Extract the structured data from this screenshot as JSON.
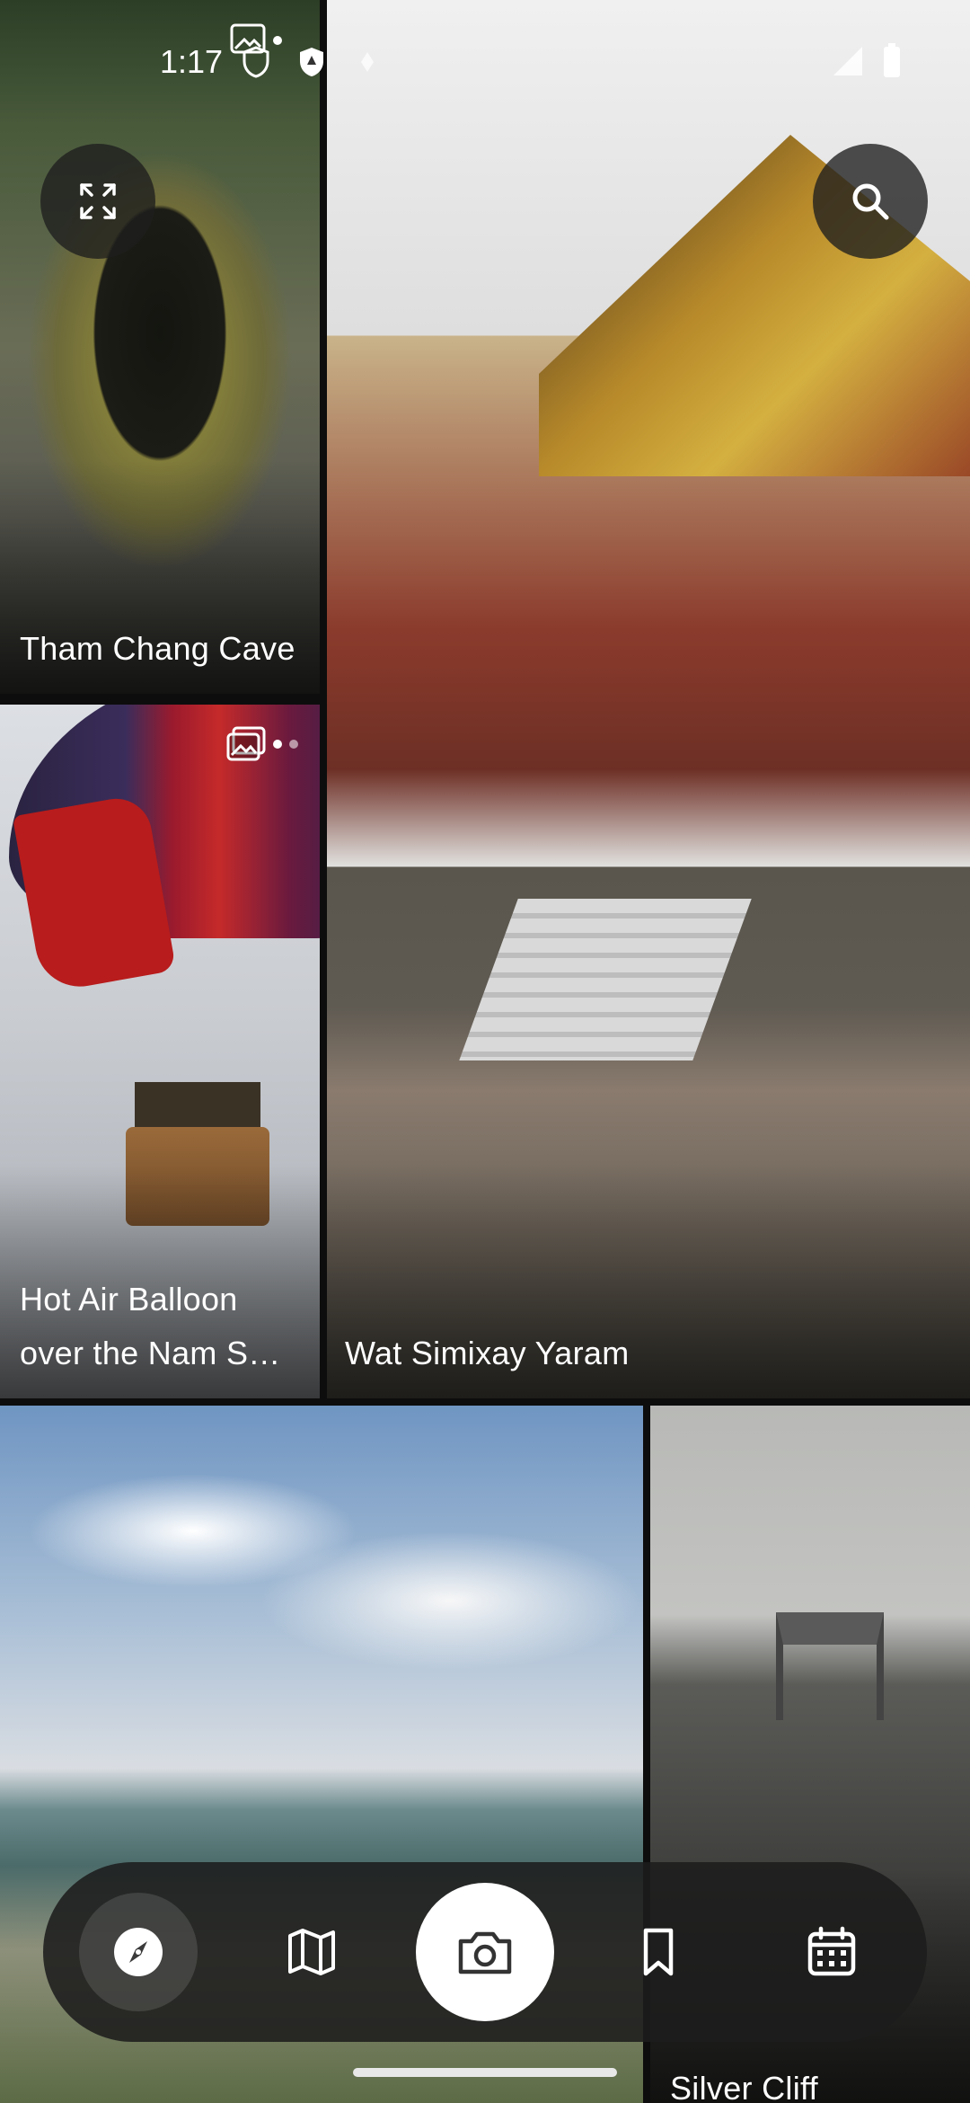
{
  "status_bar": {
    "time": "1:17"
  },
  "tiles": [
    {
      "caption": "Tham Chang Cave"
    },
    {
      "caption": "Hot Air Balloon over the Nam S…"
    },
    {
      "caption": "Wat Simixay Yaram"
    },
    {
      "caption": ""
    },
    {
      "caption": "Silver Cliff"
    }
  ],
  "controls": {
    "expand_icon": "expand-icon",
    "search_icon": "search-icon"
  },
  "bottom_nav": {
    "items": [
      {
        "icon": "compass-icon",
        "active": true
      },
      {
        "icon": "map-icon",
        "active": false
      },
      {
        "icon": "camera-icon",
        "active": false
      },
      {
        "icon": "bookmark-icon",
        "active": false
      },
      {
        "icon": "calendar-icon",
        "active": false
      }
    ]
  },
  "colors": {
    "nav_bg": "#1c1c1c",
    "camera_button": "#ffffff",
    "caption_text": "#ffffff"
  }
}
